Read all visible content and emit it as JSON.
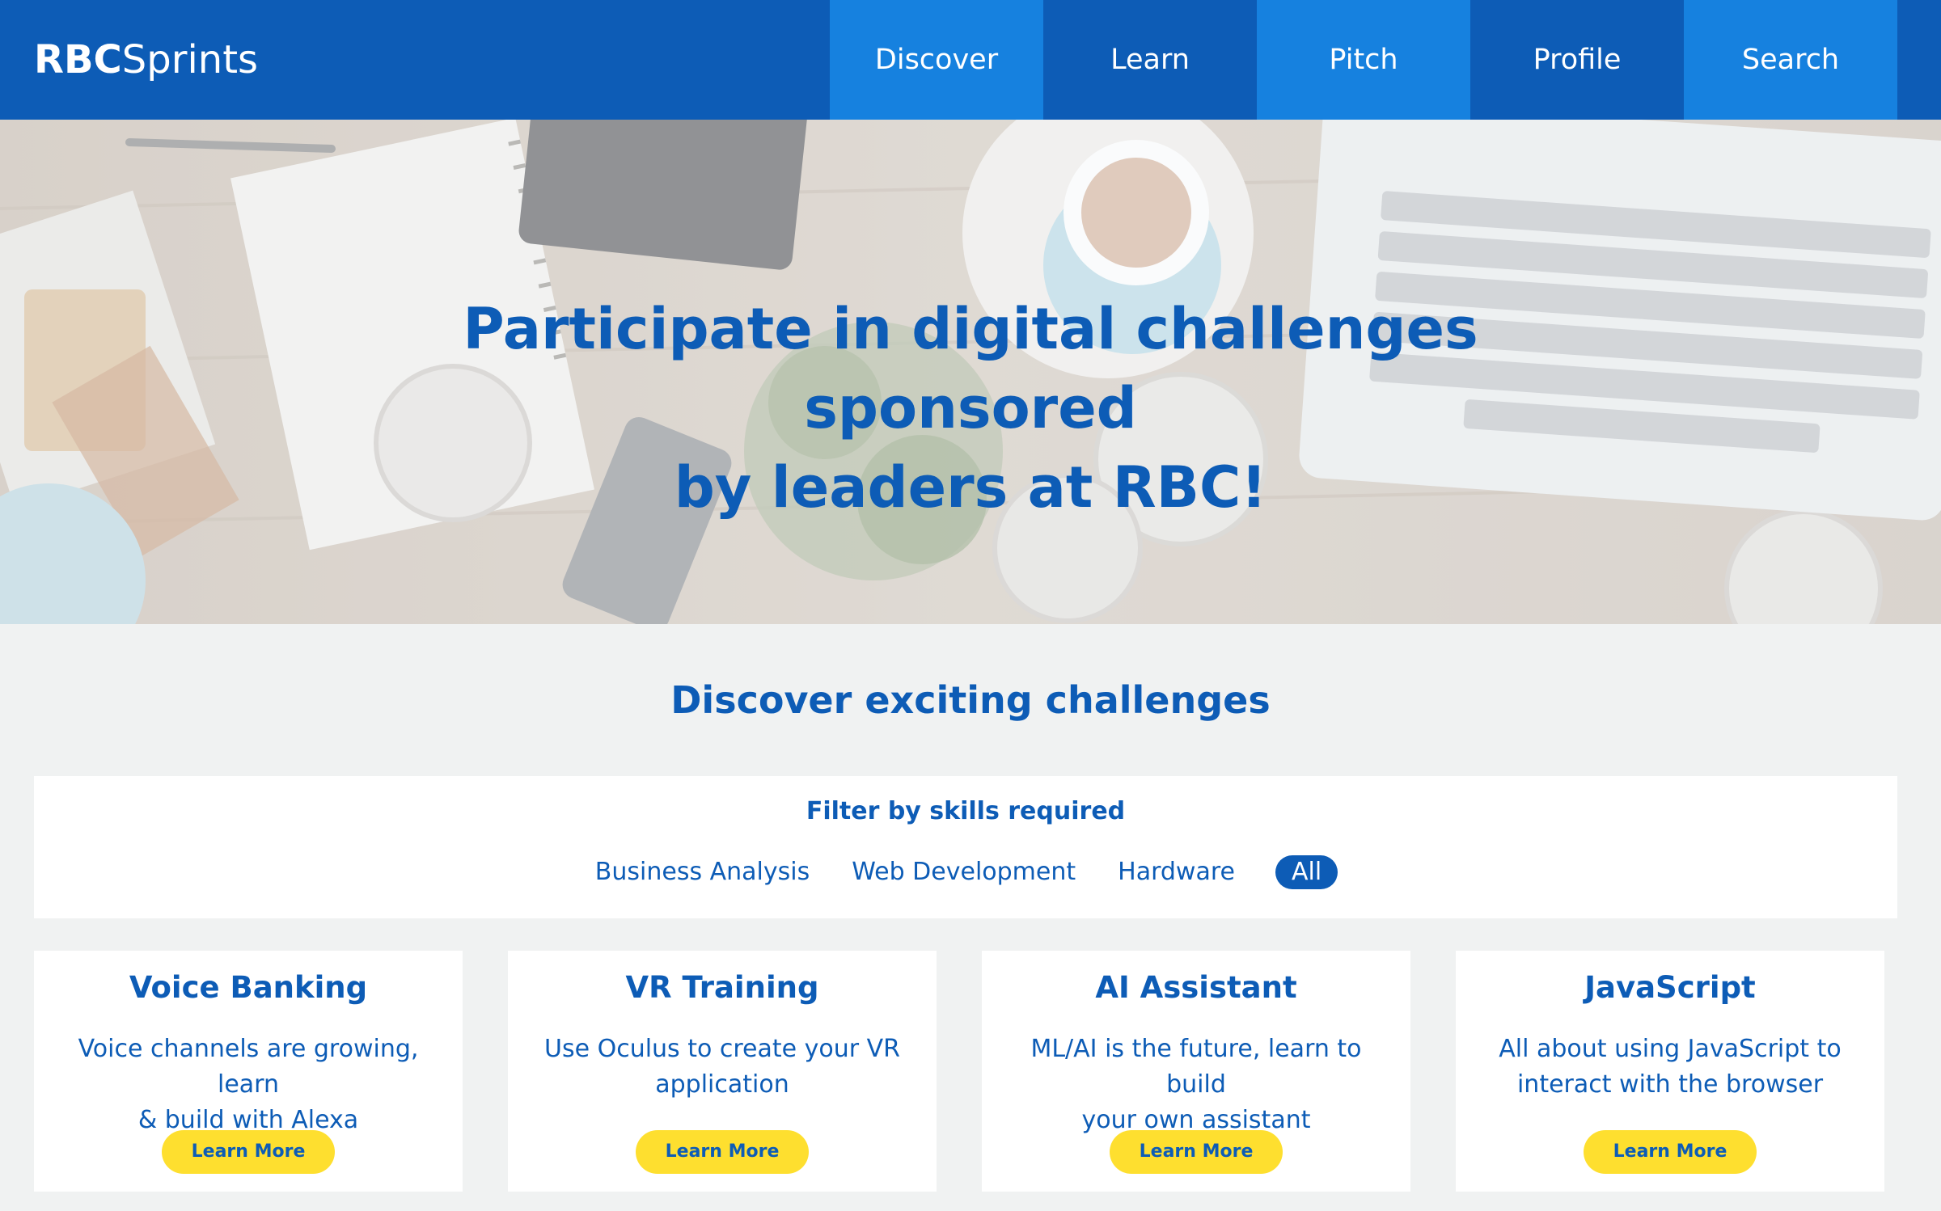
{
  "brand": {
    "part1": "RBC",
    "part2": "Sprints"
  },
  "nav": {
    "items": [
      {
        "label": "Discover"
      },
      {
        "label": "Learn"
      },
      {
        "label": "Pitch"
      },
      {
        "label": "Profile"
      },
      {
        "label": "Search"
      }
    ]
  },
  "hero": {
    "line1": "Participate in digital challenges sponsored",
    "line2": "by leaders at RBC!"
  },
  "section": {
    "title": "Discover exciting challenges"
  },
  "filter": {
    "title": "Filter by skills required",
    "tags": [
      {
        "label": "Business Analysis"
      },
      {
        "label": "Web Development"
      },
      {
        "label": "Hardware"
      },
      {
        "label": "All"
      }
    ],
    "active": "All"
  },
  "cards": [
    {
      "title": "Voice Banking",
      "desc1": "Voice channels are growing, learn",
      "desc2": "& build with Alexa",
      "button": "Learn More"
    },
    {
      "title": "VR Training",
      "desc1": "Use Oculus to create your VR",
      "desc2": "application",
      "button": "Learn More"
    },
    {
      "title": "AI Assistant",
      "desc1": "ML/AI is the future, learn to build",
      "desc2": "your own assistant",
      "button": "Learn More"
    },
    {
      "title": "JavaScript",
      "desc1": "All about using JavaScript to",
      "desc2": "interact with the browser",
      "button": "Learn More"
    }
  ],
  "colors": {
    "primary": "#0d5cb6",
    "nav_light": "#1681df",
    "page_bg": "#f0f2f2",
    "button_yellow": "#fedf2f"
  }
}
